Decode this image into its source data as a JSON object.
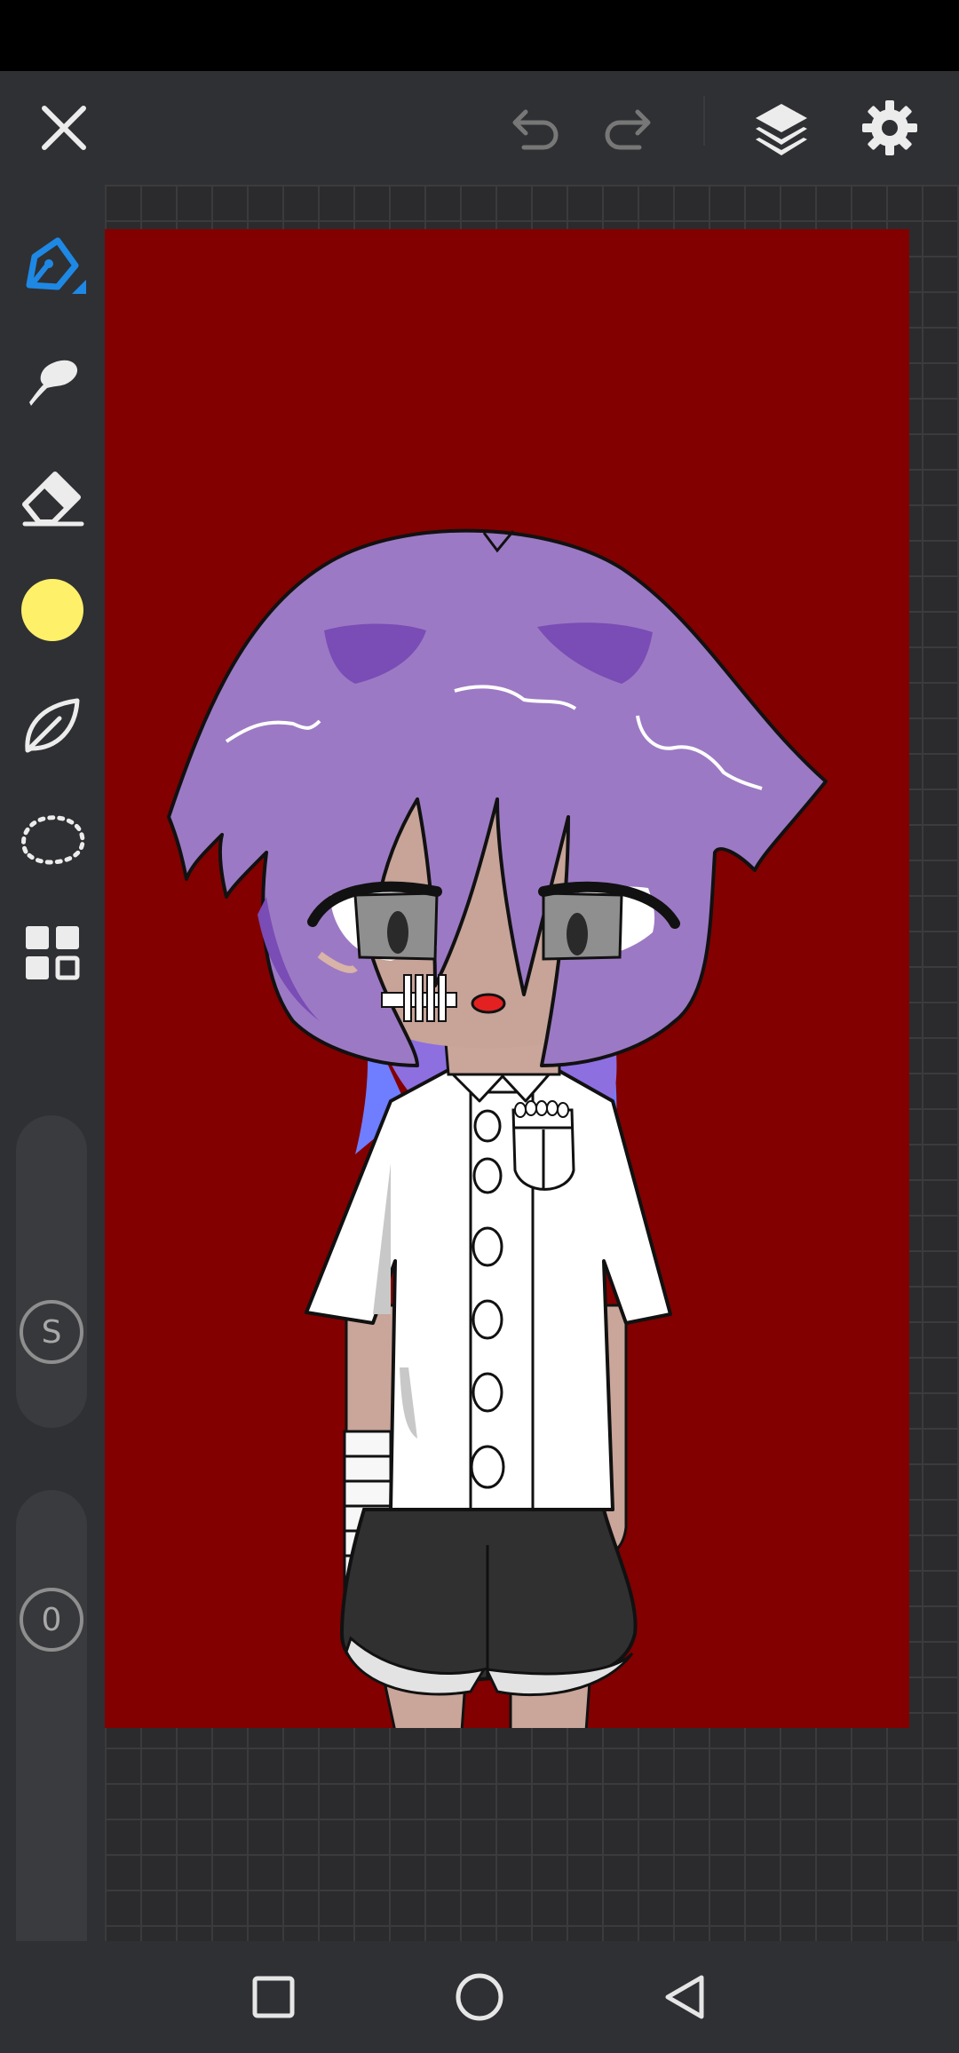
{
  "app": {
    "colors": {
      "status_bar": "#000000",
      "chrome": "#2f3033",
      "grid_bg": "#2b2b2d",
      "grid_line": "#3b3b3e",
      "canvas_bg": "#820000",
      "active_tool": "#1e88e5",
      "current_color": "#fff06a"
    }
  },
  "top_bar": {
    "icons": [
      "close-icon",
      "undo-icon",
      "redo-icon",
      "layers-icon",
      "gear-icon"
    ]
  },
  "toolbar": {
    "tools": [
      "pen-icon",
      "smudge-icon",
      "eraser-icon",
      "color-swatch",
      "shape-icon",
      "lasso-select-icon",
      "grid-menu-icon"
    ]
  },
  "sliders": {
    "size": {
      "label": "S"
    },
    "opacity": {
      "label": "0"
    }
  },
  "nav": {
    "icons": [
      "recents-icon",
      "home-icon",
      "back-icon"
    ]
  }
}
